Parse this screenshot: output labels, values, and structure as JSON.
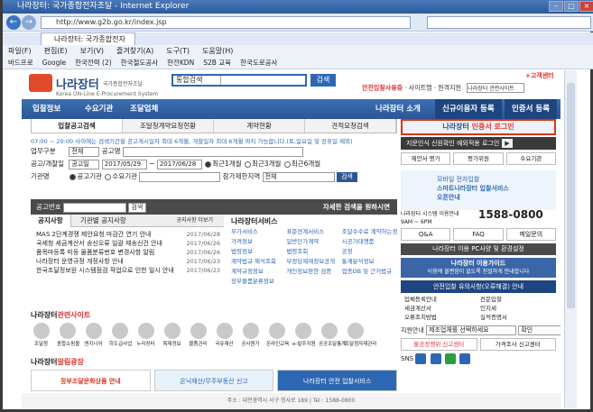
{
  "window": {
    "title": "나라장터: 국가종합전자조달 - Internet Explorer",
    "url": "http://www.g2b.go.kr/index.jsp",
    "tab": "나라장터: 국가종합전자조...",
    "search_placeholder": ""
  },
  "menu": [
    "파일(F)",
    "편집(E)",
    "보기(V)",
    "즐겨찾기(A)",
    "도구(T)",
    "도움말(H)"
  ],
  "favorites": [
    "바드프로",
    "Google",
    "한국전력 (2)",
    "한국철도공사",
    "한전KDN",
    "S2B 교육",
    "한국도로공사"
  ],
  "header": {
    "logo": "나라장터",
    "logo_sub": "국가종합전자조달",
    "logo_en": "Korea ON-Line E-Procurement System",
    "search_select": "통합검색",
    "search_btn": "검색",
    "safe": "안전입찰사용중",
    "sitemap": "· 사이트맵 · 원격지원",
    "site_select": "나라장터 관련사이트",
    "helpdesk": "+고객센터"
  },
  "gnb": {
    "bid": "입찰정보",
    "demand": "수요기관",
    "supplier": "조달업체",
    "intro": "나라장터 소개",
    "newuser": "신규이용자 등록",
    "cert": "인증서 등록"
  },
  "tabs": [
    "입찰공고검색",
    "조달청계약요청현황",
    "계약현황",
    "견적요청검색"
  ],
  "notice": "07:00 ~ 20:00 사이에는 검색기간을 공고게시일자 최대 6개월, 개찰일자 최대 6개월 까지 가능합니다.(토,일요일 및 공휴일 제외)",
  "form": {
    "biz_label": "업무구분",
    "biz_val": "전체",
    "title_label": "공고명",
    "date_label": "공고/개찰일",
    "date_type": "공고일",
    "date_from": "2017/05/29",
    "date_to": "2017/06/28",
    "r1": "최근1개월",
    "r3": "최근3개월",
    "r6": "최근6개월",
    "org_label": "기관명",
    "org1": "공고기관",
    "org2": "수요기관",
    "region_label": "참가제한지역",
    "region_val": "전체",
    "search_btn": "검색",
    "no_label": "공고번호",
    "no_btn": "검색",
    "advanced": "자세한 검색을 원하시면"
  },
  "board": {
    "tab1": "공지사항",
    "tab2": "기관별 공지사항",
    "more": "공지사항 더보기",
    "items": [
      {
        "t": "MAS 2단계경쟁 제안요청 마감간 연기 안내",
        "d": "2017/06/28"
      },
      {
        "t": "국세청 세금계산서 송신오류 일괄 재송신건 안내",
        "d": "2017/06/26"
      },
      {
        "t": "품목마등록 미등 물품분류번호 변경사항 알림",
        "d": "2017/06/26"
      },
      {
        "t": "나라장터 운영규정 개정사항 안내",
        "d": "2017/06/23"
      },
      {
        "t": "한국조달정보원 시스템점검 작업으로 인한 일시 안내",
        "d": "2017/06/23"
      }
    ]
  },
  "service": {
    "title": "나라장터서비스",
    "items": [
      "부가서비스",
      "표준연계서비스",
      "조달수수료 계약하는정밀공개",
      "가격정보",
      "일반단가계약",
      "시공가대행품",
      "법령정보",
      "법령조회",
      "공정",
      "계약예규",
      "고시",
      "계약법규 해석조회",
      "부정당제재정보공개",
      "통계분석정보",
      "계약규정정보",
      "개인정보판한 검증",
      "업종DB 및 근거법규",
      "정부물품분류정보"
    ]
  },
  "related": {
    "title": "나라장터",
    "title2": "관련사이트",
    "items": [
      "조달청",
      "종합쇼핑몰",
      "엔지니어",
      "하도급사업",
      "누리장터",
      "목재정보",
      "물품관리",
      "국유재산",
      "공사원가",
      "온라인교육",
      "e-발주지원",
      "공공조달통계",
      "조달청자재관리"
    ]
  },
  "ads": {
    "title": "나라장터",
    "title2": "알림광장",
    "b1": "정부조달문화상품 안내",
    "b2": "온닉재산/무주부동산 신고",
    "b3": "나라장터 안전 입찰서비스"
  },
  "footer": "주소 : 대전광역시 서구 청사로 189 | Tel : 1588-0800",
  "right": {
    "login": "나라장터",
    "login2": "인증서 로그인",
    "certbar": "지문인식 신원확인 예외적용 로그인",
    "register": "제안서 평가",
    "eval1": "평가위원",
    "eval2": "수요기관",
    "mobile1": "모바일 전자입찰",
    "mobile2": "스마트나라장터 입찰서비스",
    "mobile3": "오픈안내",
    "call_label": "나라장터 시스템 이용안내",
    "call_hours": "9AM ~ 6PM",
    "call_num": "1588-0800",
    "qa": "Q&A",
    "faq": "FAQ",
    "mail": "메일문의",
    "greenbar": "나라장터 이용 PC사양 및 환경설정",
    "navy1": "나라장터 이용가이드",
    "navy2": "이용에 불편함이 없도록 친절하게 안내합니다",
    "bluebar": "안전입찰 유의사항(오류해결) 안내",
    "links": [
      "업체등록안내",
      "전문입찰",
      "세금계산서",
      "인지세",
      "오류조치방법",
      "실적증명서"
    ],
    "site_label": "지원안내",
    "site_select": "제조업체를 선택하세요",
    "site_btn": "확인",
    "org1": "불공정행위 신고센터",
    "org2": "가격조사 신고센터",
    "sns": "SNS"
  }
}
